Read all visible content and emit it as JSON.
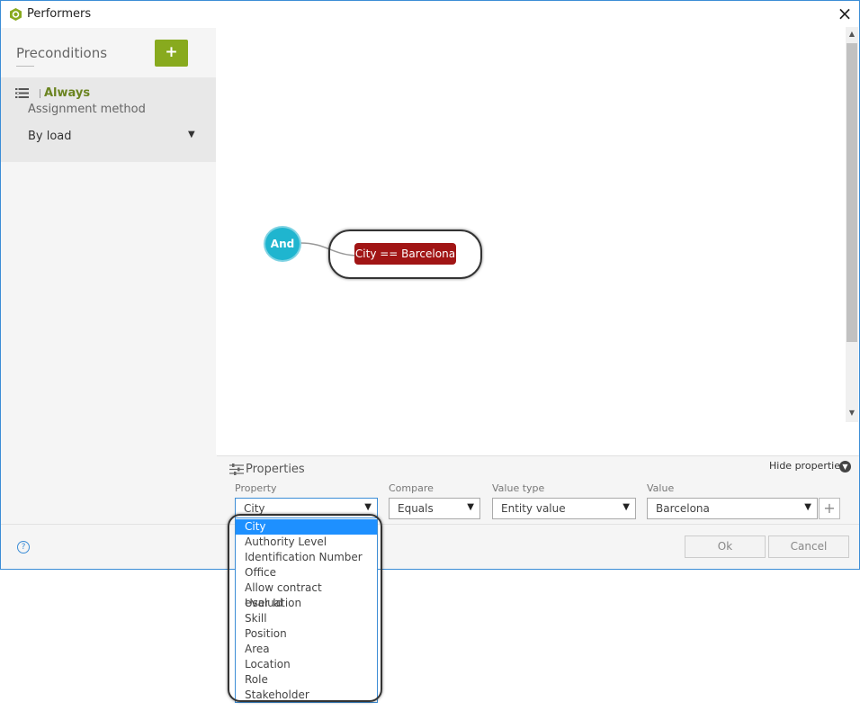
{
  "window": {
    "title": "Performers"
  },
  "sidebar": {
    "title": "Preconditions",
    "add_label": "+",
    "item": {
      "name": "Always",
      "assignment_label": "Assignment method",
      "assignment_value": "By load"
    }
  },
  "canvas": {
    "and_node": "And",
    "condition_node": "City == Barcelona"
  },
  "properties": {
    "title": "Properties",
    "hide_label": "Hide properties",
    "property": {
      "label": "Property",
      "value": "City"
    },
    "compare": {
      "label": "Compare",
      "value": "Equals"
    },
    "value_type": {
      "label": "Value type",
      "value": "Entity value"
    },
    "value": {
      "label": "Value",
      "value": "Barcelona"
    },
    "add_label": "+"
  },
  "footer": {
    "ok": "Ok",
    "cancel": "Cancel",
    "help": "?"
  },
  "dropdown": {
    "items": [
      "City",
      "Authority Level",
      "Identification Number",
      "Office",
      "Allow contract evaluation",
      "User Id",
      "Skill",
      "Position",
      "Area",
      "Location",
      "Role",
      "Stakeholder"
    ],
    "selected_index": 0
  },
  "colors": {
    "accent": "#3c8dd6",
    "add_button": "#88aa1e",
    "and_node": "#1fb5cf",
    "condition_node": "#a11515",
    "selected_item": "#1e90ff"
  }
}
